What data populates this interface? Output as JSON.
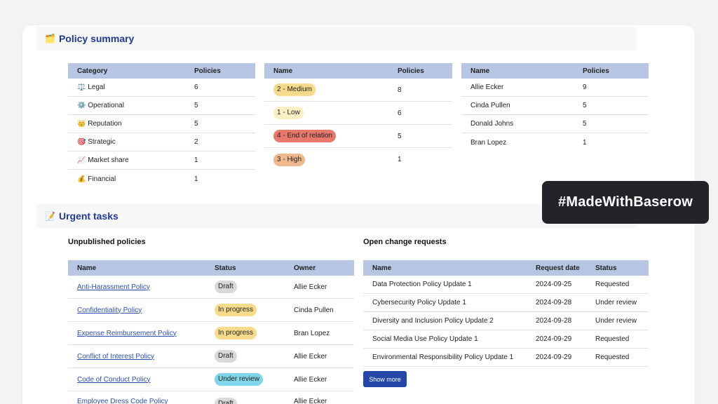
{
  "policy_summary": {
    "title": "Policy summary",
    "icon": "🗂️",
    "category_table": {
      "headers": [
        "Category",
        "Policies"
      ],
      "rows": [
        {
          "icon": "⚖️",
          "name": "Legal",
          "count": "6"
        },
        {
          "icon": "⚙️",
          "name": "Operational",
          "count": "5"
        },
        {
          "icon": "👑",
          "name": "Reputation",
          "count": "5"
        },
        {
          "icon": "🎯",
          "name": "Strategic",
          "count": "2"
        },
        {
          "icon": "📈",
          "name": "Market share",
          "count": "1"
        },
        {
          "icon": "💰",
          "name": "Financial",
          "count": "1"
        }
      ]
    },
    "priority_table": {
      "headers": [
        "Name",
        "Policies"
      ],
      "rows": [
        {
          "name": "2 - Medium",
          "count": "8",
          "color": "#f6dc8a"
        },
        {
          "name": "1 - Low",
          "count": "6",
          "color": "#fbefc4"
        },
        {
          "name": "4 - End of relation",
          "count": "5",
          "color": "#e7786b"
        },
        {
          "name": "3 - High",
          "count": "1",
          "color": "#efb98d"
        }
      ]
    },
    "owner_table": {
      "headers": [
        "Name",
        "Policies"
      ],
      "rows": [
        {
          "name": "Allie Ecker",
          "count": "9"
        },
        {
          "name": "Cinda Pullen",
          "count": "5"
        },
        {
          "name": "Donald Johns",
          "count": "5"
        },
        {
          "name": "Bran Lopez",
          "count": "1"
        }
      ]
    }
  },
  "urgent_tasks": {
    "title": "Urgent tasks",
    "icon": "📝",
    "unpublished": {
      "title": "Unpublished policies",
      "headers": [
        "Name",
        "Status",
        "Owner"
      ],
      "rows": [
        {
          "name": "Anti-Harassment Policy",
          "status": "Draft",
          "status_color": "#d9d9d9",
          "owner": "Allie Ecker"
        },
        {
          "name": "Confidentiality Policy",
          "status": "In progress",
          "status_color": "#f6dc8a",
          "owner": "Cinda Pullen"
        },
        {
          "name": "Expense Reimbursement Policy",
          "status": "In progress",
          "status_color": "#f6dc8a",
          "owner": "Bran Lopez"
        },
        {
          "name": "Conflict of Interest Policy",
          "status": "Draft",
          "status_color": "#d9d9d9",
          "owner": "Allie Ecker"
        },
        {
          "name": "Code of Conduct Policy",
          "status": "Under review",
          "status_color": "#7fd6e8",
          "owner": "Allie Ecker"
        },
        {
          "name": "Employee Dress Code Policy",
          "status": "Draft",
          "status_color": "#d9d9d9",
          "owner": "Allie Ecker"
        }
      ]
    },
    "change_requests": {
      "title": "Open change requests",
      "headers": [
        "Name",
        "Request date",
        "Status"
      ],
      "rows": [
        {
          "name": "Data Protection Policy Update 1",
          "date": "2024-09-25",
          "status": "Requested"
        },
        {
          "name": "Cybersecurity Policy Update 1",
          "date": "2024-09-28",
          "status": "Under review"
        },
        {
          "name": "Diversity and Inclusion Policy Update 2",
          "date": "2024-09-28",
          "status": "Under review"
        },
        {
          "name": "Social Media Use Policy Update 1",
          "date": "2024-09-29",
          "status": "Requested"
        },
        {
          "name": "Environmental Responsibility Policy Update 1",
          "date": "2024-09-29",
          "status": "Requested"
        }
      ],
      "show_more_label": "Show more"
    }
  },
  "badge": "#MadeWithBaserow"
}
